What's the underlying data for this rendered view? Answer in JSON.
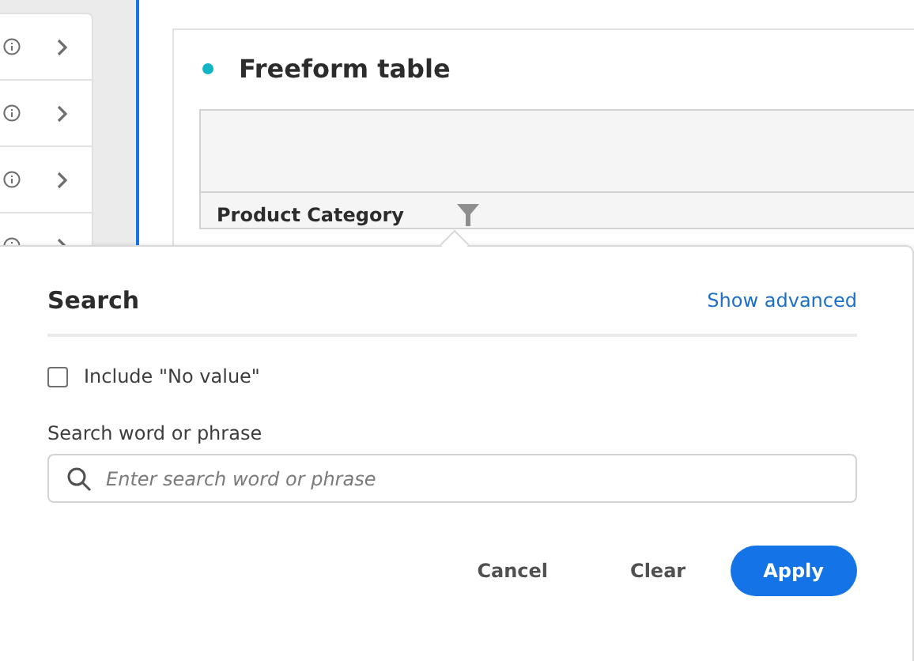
{
  "sidebar": {
    "items": [
      {
        "kind": "row"
      },
      {
        "kind": "row"
      },
      {
        "kind": "row"
      },
      {
        "kind": "row"
      }
    ]
  },
  "panel": {
    "title": "Freeform table",
    "table": {
      "column_header": "Product Category"
    }
  },
  "popover": {
    "title": "Search",
    "advanced_link": "Show advanced",
    "include_no_value": {
      "label": "Include \"No value\"",
      "checked": false
    },
    "search": {
      "label": "Search word or phrase",
      "placeholder": "Enter search word or phrase"
    },
    "buttons": [
      {
        "label": "Cancel",
        "kind": "quiet"
      },
      {
        "label": "Clear",
        "kind": "quiet"
      },
      {
        "label": "Apply",
        "kind": "primary"
      }
    ]
  }
}
